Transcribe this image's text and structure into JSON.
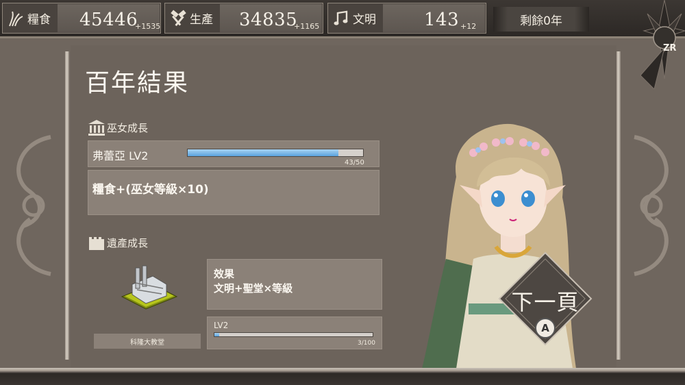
{
  "resources": [
    {
      "label": "糧食",
      "value": "45446",
      "delta": "+1535",
      "icon": "wheat-icon"
    },
    {
      "label": "生產",
      "value": "34835",
      "delta": "+1165",
      "icon": "hammer-icon"
    },
    {
      "label": "文明",
      "value": "143",
      "delta": "+12",
      "icon": "music-note-icon"
    }
  ],
  "years_remaining": "剩餘0年",
  "shoulder_button": "ZR",
  "title": "百年結果",
  "maiden_section": {
    "heading": "巫女成長",
    "icon": "temple-icon",
    "character": "弗蕾亞 LV2",
    "exp_text": "43/50",
    "exp_fraction": 0.86,
    "effect": "糧食+(巫女等級×10)"
  },
  "heritage_section": {
    "heading": "遺產成長",
    "icon": "castle-icon",
    "building_name": "科隆大教堂",
    "effect_title": "效果",
    "effect_text": "文明+聖堂×等級",
    "level": "LV2",
    "exp_text": "3/100",
    "exp_fraction": 0.03
  },
  "next_button": {
    "label": "下一頁",
    "key": "A"
  },
  "colors": {
    "accent_bar": "#5aa3de",
    "panel": "#6c635b",
    "box": "#8b8178"
  }
}
